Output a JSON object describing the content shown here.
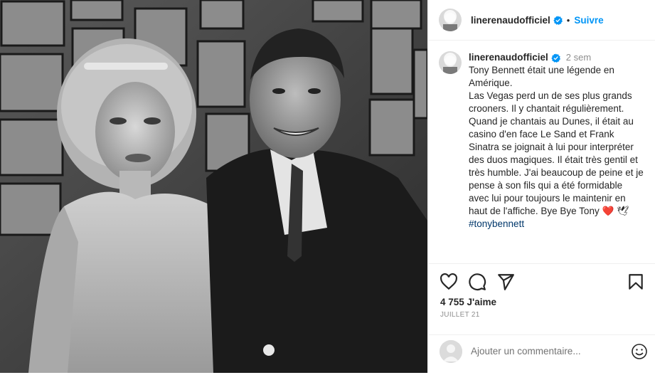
{
  "account": {
    "username": "linerenaudofficiel",
    "follow_label": "Suivre",
    "separator": "•"
  },
  "caption": {
    "username": "linerenaudofficiel",
    "time": "2 sem",
    "text": "Tony Bennett était une légende en Amérique.\nLas Vegas perd un de ses plus grands crooners. Il y chantait régulièrement.\nQuand je chantais au Dunes, il était au casino d'en face Le Sand et Frank Sinatra se joignait à lui pour interpréter des duos magiques. Il était très gentil et très humble. J'ai beaucoup de peine et je pense à son fils qui a été formidable avec lui pour toujours le maintenir en haut de l'affiche. Bye Bye Tony ",
    "heart_emoji": "❤️",
    "dove_emoji": "🕊",
    "hashtag": "#tonybennett"
  },
  "stats": {
    "likes": "4 755 J'aime",
    "date": "JUILLET 21"
  },
  "comment_box": {
    "placeholder": "Ajouter un commentaire..."
  },
  "icons": {
    "verified": "verified-badge-icon",
    "like": "heart-outline-icon",
    "comment": "speech-bubble-icon",
    "share": "paper-plane-icon",
    "save": "bookmark-icon",
    "emoji": "smiley-icon"
  },
  "colors": {
    "accent": "#0095f6",
    "hashtag": "#00376b",
    "muted": "#8e8e8e",
    "border": "#efefef"
  }
}
